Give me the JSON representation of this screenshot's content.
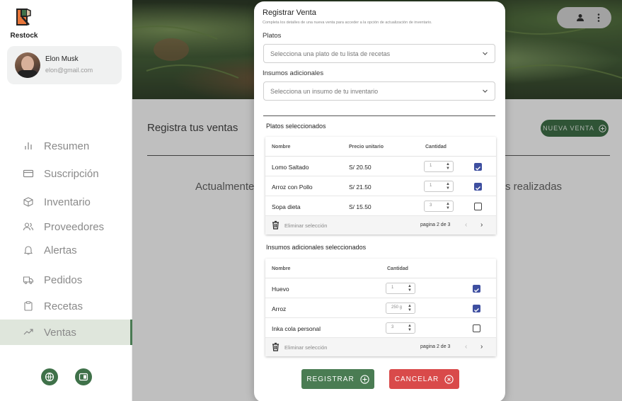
{
  "app": {
    "name": "Restock"
  },
  "user": {
    "name": "Elon Musk",
    "email": "elon@gmail.com"
  },
  "sidebar": {
    "items": [
      {
        "label": "Resumen",
        "icon": "bar-chart-icon"
      },
      {
        "label": "Suscripción",
        "icon": "credit-card-icon"
      },
      {
        "label": "Inventario",
        "icon": "box-icon"
      },
      {
        "label": "Proveedores",
        "icon": "users-icon"
      },
      {
        "label": "Alertas",
        "icon": "bell-icon"
      },
      {
        "label": "Pedidos",
        "icon": "truck-icon"
      },
      {
        "label": "Recetas",
        "icon": "clipboard-icon"
      },
      {
        "label": "Ventas",
        "icon": "trending-up-icon",
        "active": true
      }
    ]
  },
  "main": {
    "title": "Registra tus ventas",
    "new_sale": "NUEVA VENTA",
    "empty_left": "Actualmente",
    "empty_right": "s realizadas"
  },
  "modal": {
    "title": "Registrar Venta",
    "subtitle": "Completa los detalles de una nueva venta para acceder a la opción de actualización de inventario.",
    "platos_label": "Platos",
    "platos_placeholder": "Selecciona una plato de tu lista de recetas",
    "insumos_label": "Insumos adicionales",
    "insumos_placeholder": "Selecciona un insumo de tu inventario",
    "platos_section": "Platos seleccionados",
    "platos_table": {
      "headers": {
        "name": "Nombre",
        "price": "Precio unitario",
        "qty": "Cantidad"
      },
      "rows": [
        {
          "name": "Lomo Saltado",
          "price": "S/ 20.50",
          "qty": "1",
          "checked": true
        },
        {
          "name": "Arroz con Pollo",
          "price": "S/ 21.50",
          "qty": "1",
          "checked": true
        },
        {
          "name": "Sopa dieta",
          "price": "S/ 15.50",
          "qty": "3",
          "checked": false
        }
      ],
      "delete": "Eliminar selección",
      "page": "pagina 2 de 3"
    },
    "insumos_section": "Insumos adicionales seleccionados",
    "insumos_table": {
      "headers": {
        "name": "Nombre",
        "qty": "Cantidad"
      },
      "rows": [
        {
          "name": "Huevo",
          "qty": "1",
          "checked": true
        },
        {
          "name": "Arroz",
          "qty": "250 g",
          "checked": true
        },
        {
          "name": "Inka cola personal",
          "qty": "3",
          "checked": false
        }
      ],
      "delete": "Eliminar selección",
      "page": "pagina 2 de 3"
    },
    "register": "REGISTRAR",
    "cancel": "CANCELAR"
  },
  "colors": {
    "accent_green": "#3f7149",
    "danger": "#d94a4a",
    "checkbox": "#3e4fa0"
  }
}
